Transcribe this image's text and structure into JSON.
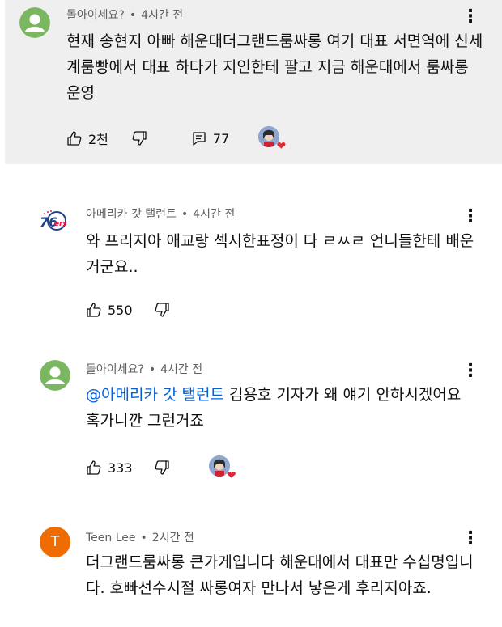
{
  "comments": [
    {
      "author": "돌아이세요?",
      "time": "4시간 전",
      "text": "현재 송현지 아빠 해운대더그랜드룸싸롱 여기 대표 서면역에 신세계룸빵에서 대표 하다가 지인한테 팔고 지금 해운대에서 룸싸롱 운영",
      "likes": "2천",
      "replies": "77",
      "avatar_icon": "default-user-avatar-green"
    },
    {
      "author": "아메리카 갓 탤런트",
      "time": "4시간 전",
      "text": "와 프리지아 애교랑 섹시한표정이 다 ㄹㅆㄹ 언니들한테 배운거군요..",
      "likes": "550",
      "avatar_icon": "76ers-logo-avatar"
    },
    {
      "author": "돌아이세요?",
      "time": "4시간 전",
      "mention": "@아메리카 갓 탤런트",
      "text": "김용호 기자가 왜 얘기 안하시겠어요 혹가니깐 그런거죠",
      "likes": "333",
      "avatar_icon": "default-user-avatar-green"
    },
    {
      "author": "Teen Lee",
      "time": "2시간 전",
      "avatar_letter": "T",
      "text": "더그랜드룸싸롱 큰가게입니다 해운대에서 대표만 수십명입니다. 호빠선수시절 싸롱여자 만나서 낳은게 후리지아죠."
    }
  ],
  "separator": "•",
  "colors": {
    "link": "#065fd4",
    "highlight_bg": "#efefef",
    "avatar_green": "#7bb661",
    "avatar_orange": "#ef6c00"
  }
}
